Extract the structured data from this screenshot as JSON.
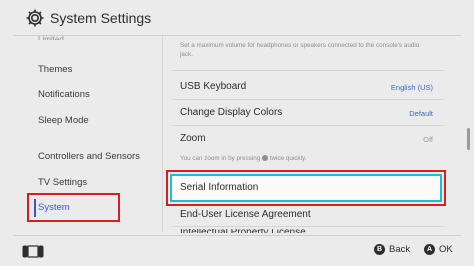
{
  "header": {
    "title": "System Settings",
    "icon": "gear-icon"
  },
  "sidebar": {
    "clipped_item": "Limited",
    "items": [
      {
        "label": "Themes"
      },
      {
        "label": "Notifications"
      },
      {
        "label": "Sleep Mode"
      },
      {
        "label": "Controllers and Sensors"
      },
      {
        "label": "TV Settings"
      },
      {
        "label": "System",
        "selected": true
      }
    ]
  },
  "main": {
    "top_description": "Set a maximum volume for headphones or speakers connected to the console's audio jack.",
    "rows": [
      {
        "label": "USB Keyboard",
        "value": "English (US)"
      },
      {
        "label": "Change Display Colors",
        "value": "Default"
      },
      {
        "label": "Zoom",
        "value": "Off",
        "description_before": "You can zoom in by pressing ",
        "description_after": " twice quickly."
      }
    ],
    "serial_information": "Serial Information",
    "eula": "End-User License Agreement",
    "partial_row": "Intellectual Property License"
  },
  "footer": {
    "back_button": "B",
    "back_label": "Back",
    "ok_button": "A",
    "ok_label": "OK"
  },
  "colors": {
    "accent": "#3a55d6",
    "focus": "#1fbcd6",
    "highlight": "#d62020",
    "value": "#3d67c8"
  }
}
